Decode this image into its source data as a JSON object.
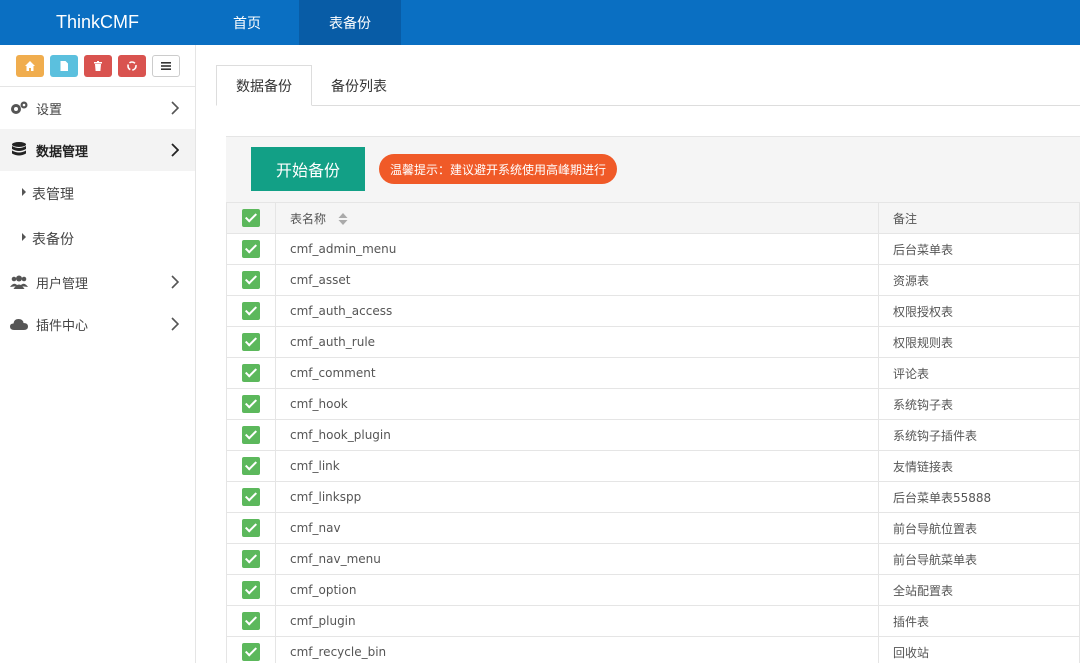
{
  "topbar": {
    "brand": "ThinkCMF",
    "nav": [
      {
        "label": "首页"
      },
      {
        "label": "表备份"
      }
    ]
  },
  "sidebar": {
    "shortcuts": [
      {
        "icon": "home-icon",
        "color": "#f0ad4e"
      },
      {
        "icon": "file-icon",
        "color": "#5bc0de"
      },
      {
        "icon": "trash-icon",
        "color": "#d9534f"
      },
      {
        "icon": "recycle-icon",
        "color": "#d9534f"
      },
      {
        "icon": "list-icon",
        "color": "#ffffff"
      }
    ],
    "menu": [
      {
        "label": "设置",
        "icon": "gears-icon"
      },
      {
        "label": "数据管理",
        "icon": "database-icon",
        "active": true
      },
      {
        "label": "表管理",
        "sub": true
      },
      {
        "label": "表备份",
        "sub": true
      },
      {
        "label": "用户管理",
        "icon": "users-icon"
      },
      {
        "label": "插件中心",
        "icon": "cloud-icon"
      }
    ]
  },
  "main": {
    "tabs": [
      {
        "label": "数据备份",
        "active": true
      },
      {
        "label": "备份列表"
      }
    ],
    "start_button": "开始备份",
    "tip": "温馨提示：建议避开系统使用高峰期进行",
    "table": {
      "headers": {
        "name": "表名称",
        "note": "备注"
      },
      "rows": [
        {
          "name": "cmf_admin_menu",
          "note": "后台菜单表"
        },
        {
          "name": "cmf_asset",
          "note": "资源表"
        },
        {
          "name": "cmf_auth_access",
          "note": "权限授权表"
        },
        {
          "name": "cmf_auth_rule",
          "note": "权限规则表"
        },
        {
          "name": "cmf_comment",
          "note": "评论表"
        },
        {
          "name": "cmf_hook",
          "note": "系统钩子表"
        },
        {
          "name": "cmf_hook_plugin",
          "note": "系统钩子插件表"
        },
        {
          "name": "cmf_link",
          "note": "友情链接表"
        },
        {
          "name": "cmf_linkspp",
          "note": "后台菜单表55888"
        },
        {
          "name": "cmf_nav",
          "note": "前台导航位置表"
        },
        {
          "name": "cmf_nav_menu",
          "note": "前台导航菜单表"
        },
        {
          "name": "cmf_option",
          "note": "全站配置表"
        },
        {
          "name": "cmf_plugin",
          "note": "插件表"
        },
        {
          "name": "cmf_recycle_bin",
          "note": "回收站"
        }
      ]
    }
  },
  "colors": {
    "topbar": "#0a6fc2",
    "active_nav": "#085ca6",
    "start_button": "#12a086",
    "tip": "#f05a28",
    "check": "#5cb85c"
  }
}
